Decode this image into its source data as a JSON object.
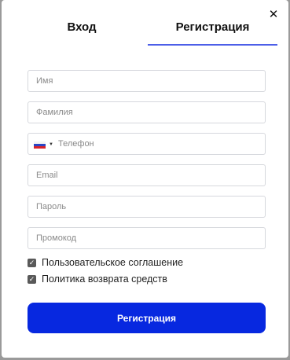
{
  "modal": {
    "close_icon": "close-icon",
    "tabs": [
      {
        "label": "Вход",
        "active": false
      },
      {
        "label": "Регистрация",
        "active": true
      }
    ],
    "accent_color": "#4d5fe8"
  },
  "form": {
    "first_name": {
      "placeholder": "Имя",
      "value": ""
    },
    "last_name": {
      "placeholder": "Фамилия",
      "value": ""
    },
    "phone": {
      "placeholder": "Телефон",
      "value": "",
      "country_flag": "russia-flag-icon"
    },
    "email": {
      "placeholder": "Email",
      "value": ""
    },
    "password": {
      "placeholder": "Пароль",
      "value": ""
    },
    "promo": {
      "placeholder": "Промокод",
      "value": ""
    },
    "agreements": [
      {
        "label": "Пользовательское соглашение",
        "checked": true
      },
      {
        "label": "Политика возврата средств",
        "checked": true
      }
    ],
    "submit_label": "Регистрация",
    "submit_color": "#0728e0"
  }
}
